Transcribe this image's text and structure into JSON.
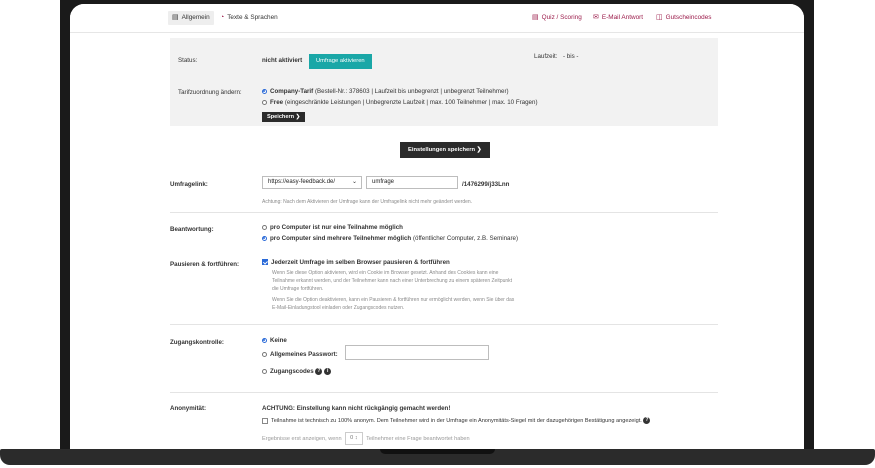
{
  "tabs": {
    "general": "Allgemein",
    "texts": "Texte & Sprachen",
    "quiz": "Quiz / Scoring",
    "email": "E-Mail Antwort",
    "vouchers": "Gutscheincodes"
  },
  "status": {
    "label": "Status:",
    "value": "nicht aktiviert",
    "activate_button": "Umfrage aktivieren",
    "runtime_label": "Laufzeit:",
    "runtime_value": "- bis -"
  },
  "tariff": {
    "label": "Tarifzuordnung ändern:",
    "option1_name": "Company-Tarif",
    "option1_detail": "(Bestell-Nr.: 378603 | Laufzeit bis unbegrenzt | unbegrenzt Teilnehmer)",
    "option2_name": "Free",
    "option2_detail": "(eingeschränkte Leistungen | Unbegrenzte Laufzeit | max. 100 Teilnehmer | max. 10 Fragen)",
    "save_button": "Speichern"
  },
  "save_settings_button": "Einstellungen speichern",
  "survey_link": {
    "label": "Umfragelink:",
    "domain": "https://easy-feedback.de/",
    "slug": "umfrage",
    "suffix": "/1476299/j33Lnn",
    "note": "Achtung: Nach dem Aktivieren der Umfrage kann der Umfragelink nicht mehr geändert werden."
  },
  "answering": {
    "label": "Beantwortung:",
    "option1": "pro Computer ist nur eine Teilnahme möglich",
    "option2": "pro Computer sind mehrere Teilnehmer möglich",
    "option2_detail": "(öffentlicher Computer, z.B. Seminare)"
  },
  "pause": {
    "label": "Pausieren & fortführen:",
    "checkbox_label": "Jederzeit Umfrage im selben Browser pausieren & fortführen",
    "desc1_line1": "Wenn Sie diese Option aktivieren, wird ein Cookie im Browser gesetzt. Anhand des Cookies kann eine",
    "desc1_line2": "Teilnahme erkannt werden, und der Teilnehmer kann nach einer Unterbrechung zu einem späteren Zeitpunkt",
    "desc1_line3": "die Umfrage fortführen.",
    "desc2_line1": "Wenn Sie die Option deaktivieren, kann ein Pausieren & fortführen nur ermöglicht werden, wenn Sie über das",
    "desc2_line2": "E-Mail-Einladungstool einladen oder Zugangscodes nutzen."
  },
  "access": {
    "label": "Zugangskontrolle:",
    "option_none": "Keine",
    "option_password": "Allgemeines Passwort:",
    "option_codes": "Zugangscodes"
  },
  "anonymity": {
    "label": "Anonymität:",
    "warning": "ACHTUNG: Einstellung kann nicht rückgängig gemacht werden!",
    "checkbox_label": "Teilnahme ist technisch zu 100% anonym. Dem Teilnehmer wird in der Umfrage ein Anonymitäts-Siegel mit der dazugehörigen Bestätigung angezeigt.",
    "results_prefix": "Ergebnisse erst anzeigen, wenn",
    "results_value": "0",
    "results_suffix": "Teilnehmer eine Frage beantwortet haben"
  },
  "colors": {
    "accent_teal": "#1aa7a7",
    "link_magenta": "#9b1b4a",
    "dark_button": "#2b2b2b"
  }
}
